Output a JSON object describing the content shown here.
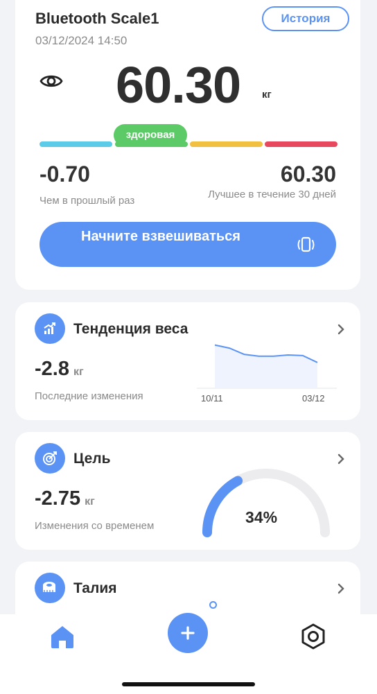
{
  "scale": {
    "device_name": "Bluetooth Scale1",
    "datetime": "03/12/2024 14:50",
    "history_label": "История",
    "weight": "60.30",
    "weight_unit": "кг",
    "status": "здоровая",
    "status_colors": [
      "#5bcbe8",
      "#5ccb67",
      "#f1c040",
      "#e8485e"
    ],
    "diff_value": "-0.70",
    "diff_label": "Чем в прошлый раз",
    "best_value": "60.30",
    "best_label": "Лучшее в течение 30 дней",
    "start_label": "Начните взвешиваться"
  },
  "trend": {
    "title": "Тенденция веса",
    "value": "-2.8",
    "unit": "кг",
    "label": "Последние изменения",
    "x_start": "10/11",
    "x_end": "03/12",
    "chart_data": {
      "type": "area",
      "x": [
        "10/11",
        "",
        "",
        "",
        "",
        "",
        "",
        "03/12"
      ],
      "values": [
        63.1,
        62.6,
        61.6,
        61.3,
        61.3,
        61.5,
        61.4,
        60.3
      ]
    }
  },
  "goal": {
    "title": "Цель",
    "value": "-2.75",
    "unit": "кг",
    "label": "Изменения со временем",
    "progress_pct": "34%",
    "progress_fraction": 0.34
  },
  "waist": {
    "title": "Талия"
  },
  "accent_color": "#5b93f5"
}
